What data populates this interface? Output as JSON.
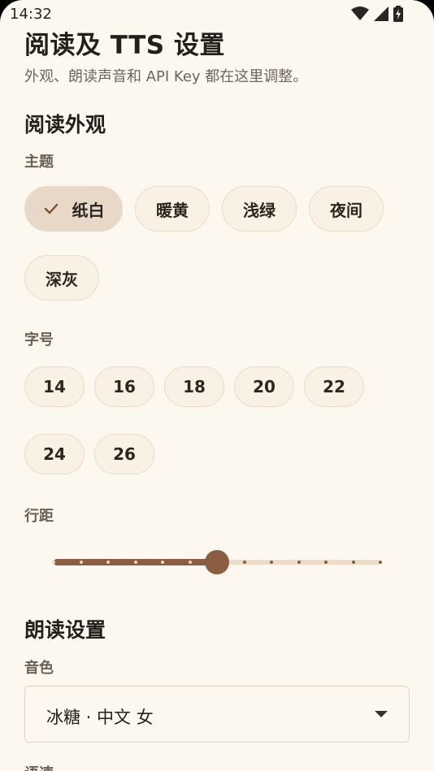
{
  "status_bar": {
    "time": "14:32"
  },
  "header": {
    "title": "阅读及 TTS 设置",
    "subtitle": "外观、朗读声音和 API Key 都在这里调整。"
  },
  "appearance": {
    "section_title": "阅读外观",
    "theme_label": "主题",
    "themes": [
      "纸白",
      "暖黄",
      "浅绿",
      "夜间",
      "深灰"
    ],
    "selected_theme": "纸白",
    "font_size_label": "字号",
    "font_sizes": [
      "14",
      "16",
      "18",
      "20",
      "22",
      "24",
      "26"
    ],
    "line_spacing_label": "行距",
    "line_spacing_fraction": 0.5
  },
  "reading": {
    "section_title": "朗读设置",
    "voice_label": "音色",
    "voice_value": "冰糖 · 中文 女",
    "speed_label": "语速"
  },
  "colors": {
    "background": "#fcf8f0",
    "accent": "#8b5e44",
    "chip_selected": "#e8d8c8"
  }
}
